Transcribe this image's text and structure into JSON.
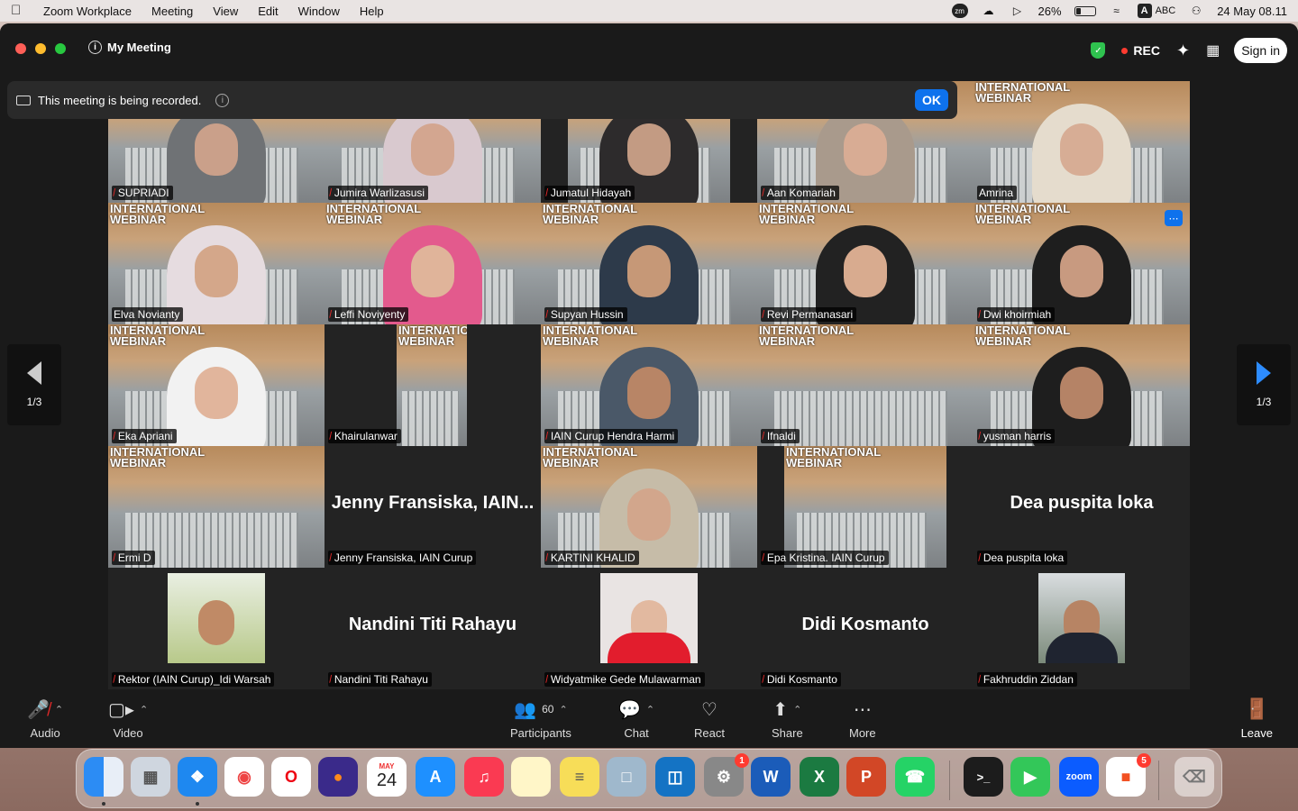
{
  "menubar": {
    "app": "Zoom Workplace",
    "items": [
      "Meeting",
      "View",
      "Edit",
      "Window",
      "Help"
    ],
    "battery_percent": "26%",
    "battery_level": 0.26,
    "input_source": "ABC",
    "input_letter": "A",
    "datetime": "24 May  08.11"
  },
  "window": {
    "title": "My Meeting",
    "rec_label": "REC",
    "signin_label": "Sign in"
  },
  "banner": {
    "text": "This meeting is being recorded.",
    "ok_label": "OK"
  },
  "pager": {
    "left_label": "1/3",
    "right_label": "1/3"
  },
  "banner_text": {
    "line1": "INTERNATIONAL",
    "line2": "WEBINAR"
  },
  "participants": [
    {
      "name": "SUPRIADI"
    },
    {
      "name": "Jumira Warlizasusi"
    },
    {
      "name": "Jumatul Hidayah"
    },
    {
      "name": "Aan Komariah"
    },
    {
      "name": "Amrina"
    },
    {
      "name": "Elva Novianty"
    },
    {
      "name": "Leffi Noviyenty"
    },
    {
      "name": "Supyan Hussin"
    },
    {
      "name": "Revi Permanasari"
    },
    {
      "name": "Dwi khoirmiah"
    },
    {
      "name": "Eka Apriani"
    },
    {
      "name": "Khairulanwar"
    },
    {
      "name": "IAIN Curup Hendra Harmi"
    },
    {
      "name": "Ifnaldi"
    },
    {
      "name": "yusman harris"
    },
    {
      "name": "Ermi D"
    },
    {
      "name": "Jenny Fransiska, IAIN Curup",
      "display": "Jenny Fransiska, IAIN..."
    },
    {
      "name": "KARTINI KHALID"
    },
    {
      "name": "Epa Kristina. IAIN Curup"
    },
    {
      "name": "Dea puspita loka",
      "display": "Dea puspita loka"
    },
    {
      "name": "Rektor (IAIN Curup)_Idi Warsah"
    },
    {
      "name": "Nandini Titi Rahayu",
      "display": "Nandini Titi Rahayu"
    },
    {
      "name": "Widyatmike Gede Mulawarman"
    },
    {
      "name": "Didi Kosmanto",
      "display": "Didi Kosmanto"
    },
    {
      "name": "Fakhruddin Ziddan"
    }
  ],
  "toolbar": {
    "audio": "Audio",
    "video": "Video",
    "participants": "Participants",
    "participant_count": "60",
    "chat": "Chat",
    "react": "React",
    "share": "Share",
    "more": "More",
    "leave": "Leave"
  },
  "dock": {
    "calendar_month": "MAY",
    "calendar_day": "24",
    "settings_badge": "1",
    "office_badge": "5",
    "zoom_label": "zoom",
    "excel_label": "X",
    "word_label": "W",
    "ppt_label": "P"
  },
  "colors": {
    "accent": "#0e72ed",
    "rec": "#ff3b30",
    "active_speaker": "#2fc24f",
    "muted": "#e02828"
  }
}
